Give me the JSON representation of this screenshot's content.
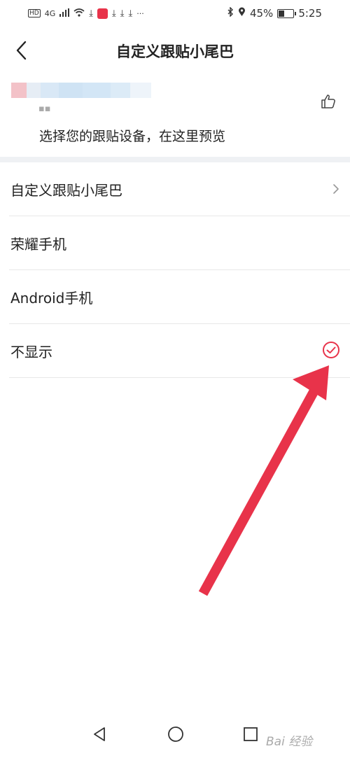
{
  "status_bar": {
    "hd": "HD",
    "network": "4G",
    "more": "···",
    "battery_percent": "45%",
    "battery_level": 0.45,
    "time": "5:25"
  },
  "header": {
    "title": "自定义跟贴小尾巴"
  },
  "preview": {
    "text": "选择您的跟贴设备，在这里预览"
  },
  "list": {
    "items": [
      {
        "label": "自定义跟贴小尾巴",
        "trailing": "chevron-right-icon"
      },
      {
        "label": "荣耀手机",
        "trailing": ""
      },
      {
        "label": "Android手机",
        "trailing": ""
      },
      {
        "label": "不显示",
        "trailing": "check-circle-icon",
        "selected": true
      }
    ]
  },
  "watermark": {
    "text": "Bai 经验"
  },
  "colors": {
    "accent_red": "#e8334a",
    "text_primary": "#222222",
    "divider": "#e8e8e8",
    "section_gap": "#eff1f4"
  }
}
